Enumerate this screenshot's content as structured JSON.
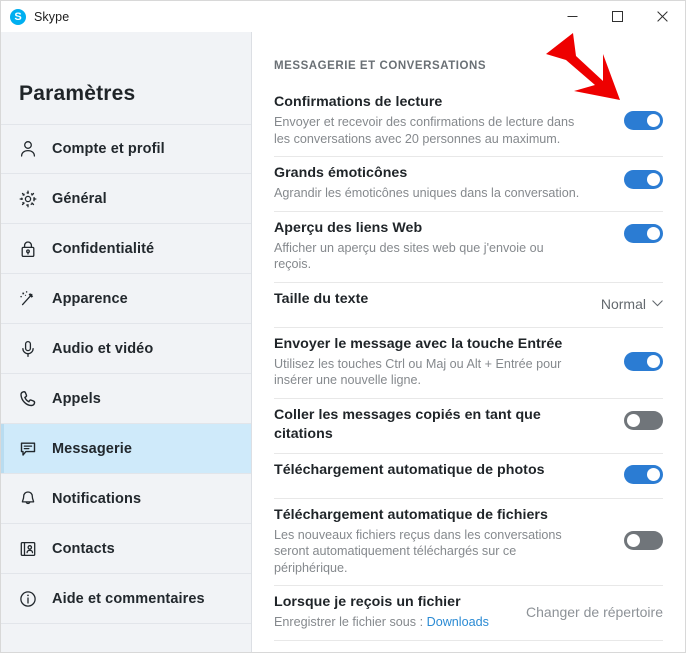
{
  "titlebar": {
    "app_name": "Skype",
    "logo_letter": "S",
    "logo_icon": "skype-logo-icon",
    "minimize_label": "—",
    "maximize_label": "☐",
    "close_label": "✕"
  },
  "sidebar": {
    "title": "Paramètres",
    "active_index": 6,
    "items": [
      {
        "label": "Compte et profil",
        "icon": "person-icon"
      },
      {
        "label": "Général",
        "icon": "gear-icon"
      },
      {
        "label": "Confidentialité",
        "icon": "lock-icon"
      },
      {
        "label": "Apparence",
        "icon": "magic-wand-icon"
      },
      {
        "label": "Audio et vidéo",
        "icon": "microphone-icon"
      },
      {
        "label": "Appels",
        "icon": "phone-icon"
      },
      {
        "label": "Messagerie",
        "icon": "chat-bubble-icon"
      },
      {
        "label": "Notifications",
        "icon": "bell-icon"
      },
      {
        "label": "Contacts",
        "icon": "contact-card-icon"
      },
      {
        "label": "Aide et commentaires",
        "icon": "info-circle-icon"
      }
    ]
  },
  "main": {
    "section_header": "MESSAGERIE ET CONVERSATIONS",
    "rows": [
      {
        "title": "Confirmations de lecture",
        "desc": "Envoyer et recevoir des confirmations de lecture dans les conversations avec 20 personnes au maximum.",
        "control": "toggle",
        "state": "on"
      },
      {
        "title": "Grands émoticônes",
        "desc": "Agrandir les émoticônes uniques dans la conversation.",
        "control": "toggle",
        "state": "on"
      },
      {
        "title": "Aperçu des liens Web",
        "desc": "Afficher un aperçu des sites web que j'envoie ou reçois.",
        "control": "toggle",
        "state": "on"
      },
      {
        "title": "Taille du texte",
        "desc": "",
        "control": "dropdown",
        "value": "Normal"
      },
      {
        "title": "Envoyer le message avec la touche Entrée",
        "desc": "Utilisez les touches Ctrl ou Maj ou Alt + Entrée pour insérer une nouvelle ligne.",
        "control": "toggle",
        "state": "on"
      },
      {
        "title": "Coller les messages copiés en tant que citations",
        "desc": "",
        "control": "toggle",
        "state": "off"
      },
      {
        "title": "Téléchargement automatique de photos",
        "desc": "",
        "control": "toggle",
        "state": "on"
      },
      {
        "title": "Téléchargement automatique de fichiers",
        "desc": "Les nouveaux fichiers reçus dans les conversations seront automatiquement téléchargés sur ce périphérique.",
        "control": "toggle",
        "state": "off"
      },
      {
        "title": "Lorsque je reçois un fichier",
        "desc_prefix": "Enregistrer le fichier sous : ",
        "desc_link": "Downloads",
        "control": "link",
        "value": "Changer de répertoire"
      }
    ]
  },
  "annotation": {
    "type": "red-arrow",
    "color": "#ee0000",
    "points_to": "Confirmations de lecture toggle"
  },
  "colors": {
    "accent_blue": "#2b7cd3",
    "toggle_off_gray": "#70757a",
    "sidebar_bg": "#f1f3f6",
    "active_item_bg": "#cfeafa",
    "link_blue": "#2b8bd4",
    "annotation_red": "#ee0000"
  }
}
